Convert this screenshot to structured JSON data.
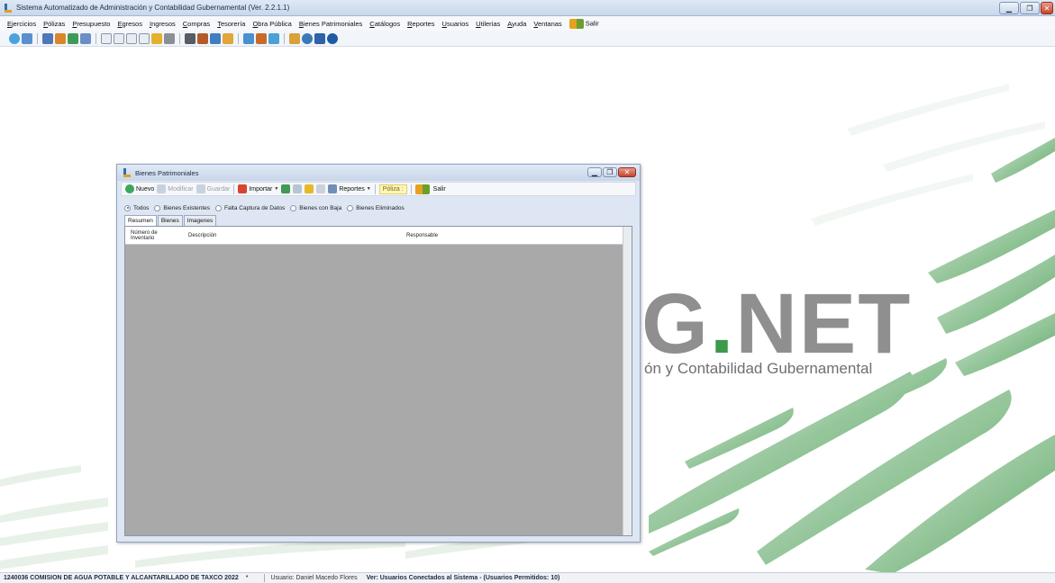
{
  "window": {
    "title": "Sistema Automatizado de Administración y Contabilidad Gubernamental  (Ver. 2.2.1.1)",
    "minimize_icon": "minimize-icon",
    "restore_icon": "restore-icon",
    "close_icon": "close-icon"
  },
  "menu": {
    "items": [
      "Ejercicios",
      "Pólizas",
      "Presupuesto",
      "Egresos",
      "Ingresos",
      "Compras",
      "Tesorería",
      "Obra Pública",
      "Bienes Patrimoniales",
      "Catálogos",
      "Reportes",
      "Usuarios",
      "Utilerias",
      "Ayuda",
      "Ventanas"
    ],
    "exit_label": "Salir"
  },
  "toolbar": {
    "icons": [
      "back-icon",
      "report-icon",
      "catalog-icon",
      "ledger-icon",
      "budget-icon",
      "chart-icon",
      "box-icon",
      "box-icon",
      "box-icon",
      "box-icon",
      "folder-icon",
      "print-icon",
      "calculator-icon",
      "tools-icon",
      "users-icon",
      "package-icon",
      "window-icon",
      "pencil-icon",
      "gear-icon",
      "tree-icon",
      "search-icon",
      "grid-icon",
      "help-icon"
    ]
  },
  "background": {
    "logo_main": "G",
    "logo_dot": ".",
    "logo_rest": "NET",
    "logo_sub": "ón y Contabilidad Gubernamental"
  },
  "status": {
    "org": "1240036 COMISION DE AGUA POTABLE Y ALCANTARILLADO DE TAXCO  2022",
    "star": "*",
    "user": "Usuario: Daniel Macedo Flores",
    "users_link": "Ver: Usuarios Conectados al Sistema  - (Usuarios Permitidos: 10)"
  },
  "child": {
    "title": "Bienes Patrimoniales",
    "toolbar": {
      "nuevo": "Nuevo",
      "modificar": "Modificar",
      "guardar": "Guardar",
      "importar": "Importar",
      "reportes": "Reportes",
      "poliza": "Póliza :",
      "salir": "Salir"
    },
    "filters": [
      "Todos",
      "Bienes Existentes",
      "Falta Captura de Datos",
      "Bienes con Baja",
      "Bienes Eliminados"
    ],
    "tabs": [
      "Resumen",
      "Bienes",
      "Imagenes"
    ],
    "grid": {
      "col_num_1": "Número de",
      "col_num_2": "Inventario",
      "col_desc": "Descripción",
      "col_resp": "Responsable"
    }
  },
  "colors": {
    "accent_blue": "#2b6fb0",
    "logo_green": "#3d9a4a",
    "grid_bg": "#a9a9a9",
    "poliza_bg": "#fff6b8"
  }
}
